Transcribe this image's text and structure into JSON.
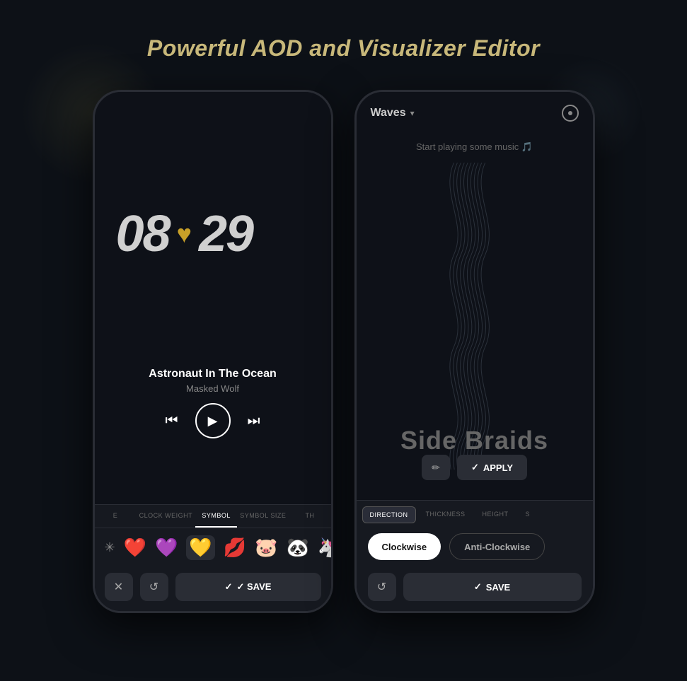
{
  "page": {
    "title": "Powerful AOD and Visualizer Editor",
    "background": "#0d1117"
  },
  "left_phone": {
    "clock": {
      "hours": "08",
      "minutes": "29",
      "separator": "♥"
    },
    "song": {
      "title": "Astronaut In The Ocean",
      "artist": "Masked Wolf"
    },
    "controls": {
      "prev": "⏮",
      "play": "▶",
      "next": "⏭"
    },
    "tabs": [
      {
        "label": "E",
        "active": false
      },
      {
        "label": "CLOCK WEIGHT",
        "active": false
      },
      {
        "label": "SYMBOL",
        "active": true
      },
      {
        "label": "SYMBOL SIZE",
        "active": false
      },
      {
        "label": "TH",
        "active": false
      }
    ],
    "emojis": [
      "✳",
      "❤️",
      "💜",
      "💛",
      "💋",
      "🐷",
      "🐼",
      "🦄"
    ],
    "selected_emoji_index": 3,
    "buttons": {
      "close": "✕",
      "reset": "↺",
      "save": "✓ SAVE"
    }
  },
  "right_phone": {
    "header": {
      "dropdown_label": "Waves",
      "dropdown_chevron": "▾",
      "settings_icon": "●"
    },
    "music_hint": "Start playing some music 🎵",
    "visualizer_title": "Side Braids",
    "buttons": {
      "edit": "✏",
      "apply": "✓ APPLY"
    },
    "tabs": [
      {
        "label": "DIRECTION",
        "active": true
      },
      {
        "label": "THICKNESS",
        "active": false
      },
      {
        "label": "HEIGHT",
        "active": false
      },
      {
        "label": "S",
        "active": false
      }
    ],
    "direction_options": [
      {
        "label": "Clockwise",
        "selected": true
      },
      {
        "label": "Anti-Clockwise",
        "selected": false
      }
    ],
    "action_buttons": {
      "reset": "↺",
      "save": "✓ SAVE"
    }
  }
}
